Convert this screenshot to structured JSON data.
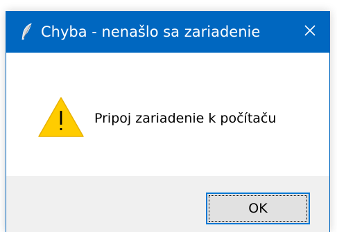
{
  "window": {
    "title": "Chyba - nenašlo sa zariadenie",
    "title_icon": "feather-icon",
    "close_icon": "close-icon"
  },
  "dialog": {
    "icon": "warning-icon",
    "message": "Pripoj zariadenie k počítaču",
    "ok_label": "OK"
  },
  "colors": {
    "titlebar": "#0067c0",
    "warning_fill": "#ffcc00",
    "button_border": "#0078d4",
    "footer": "#f0f0f0"
  }
}
